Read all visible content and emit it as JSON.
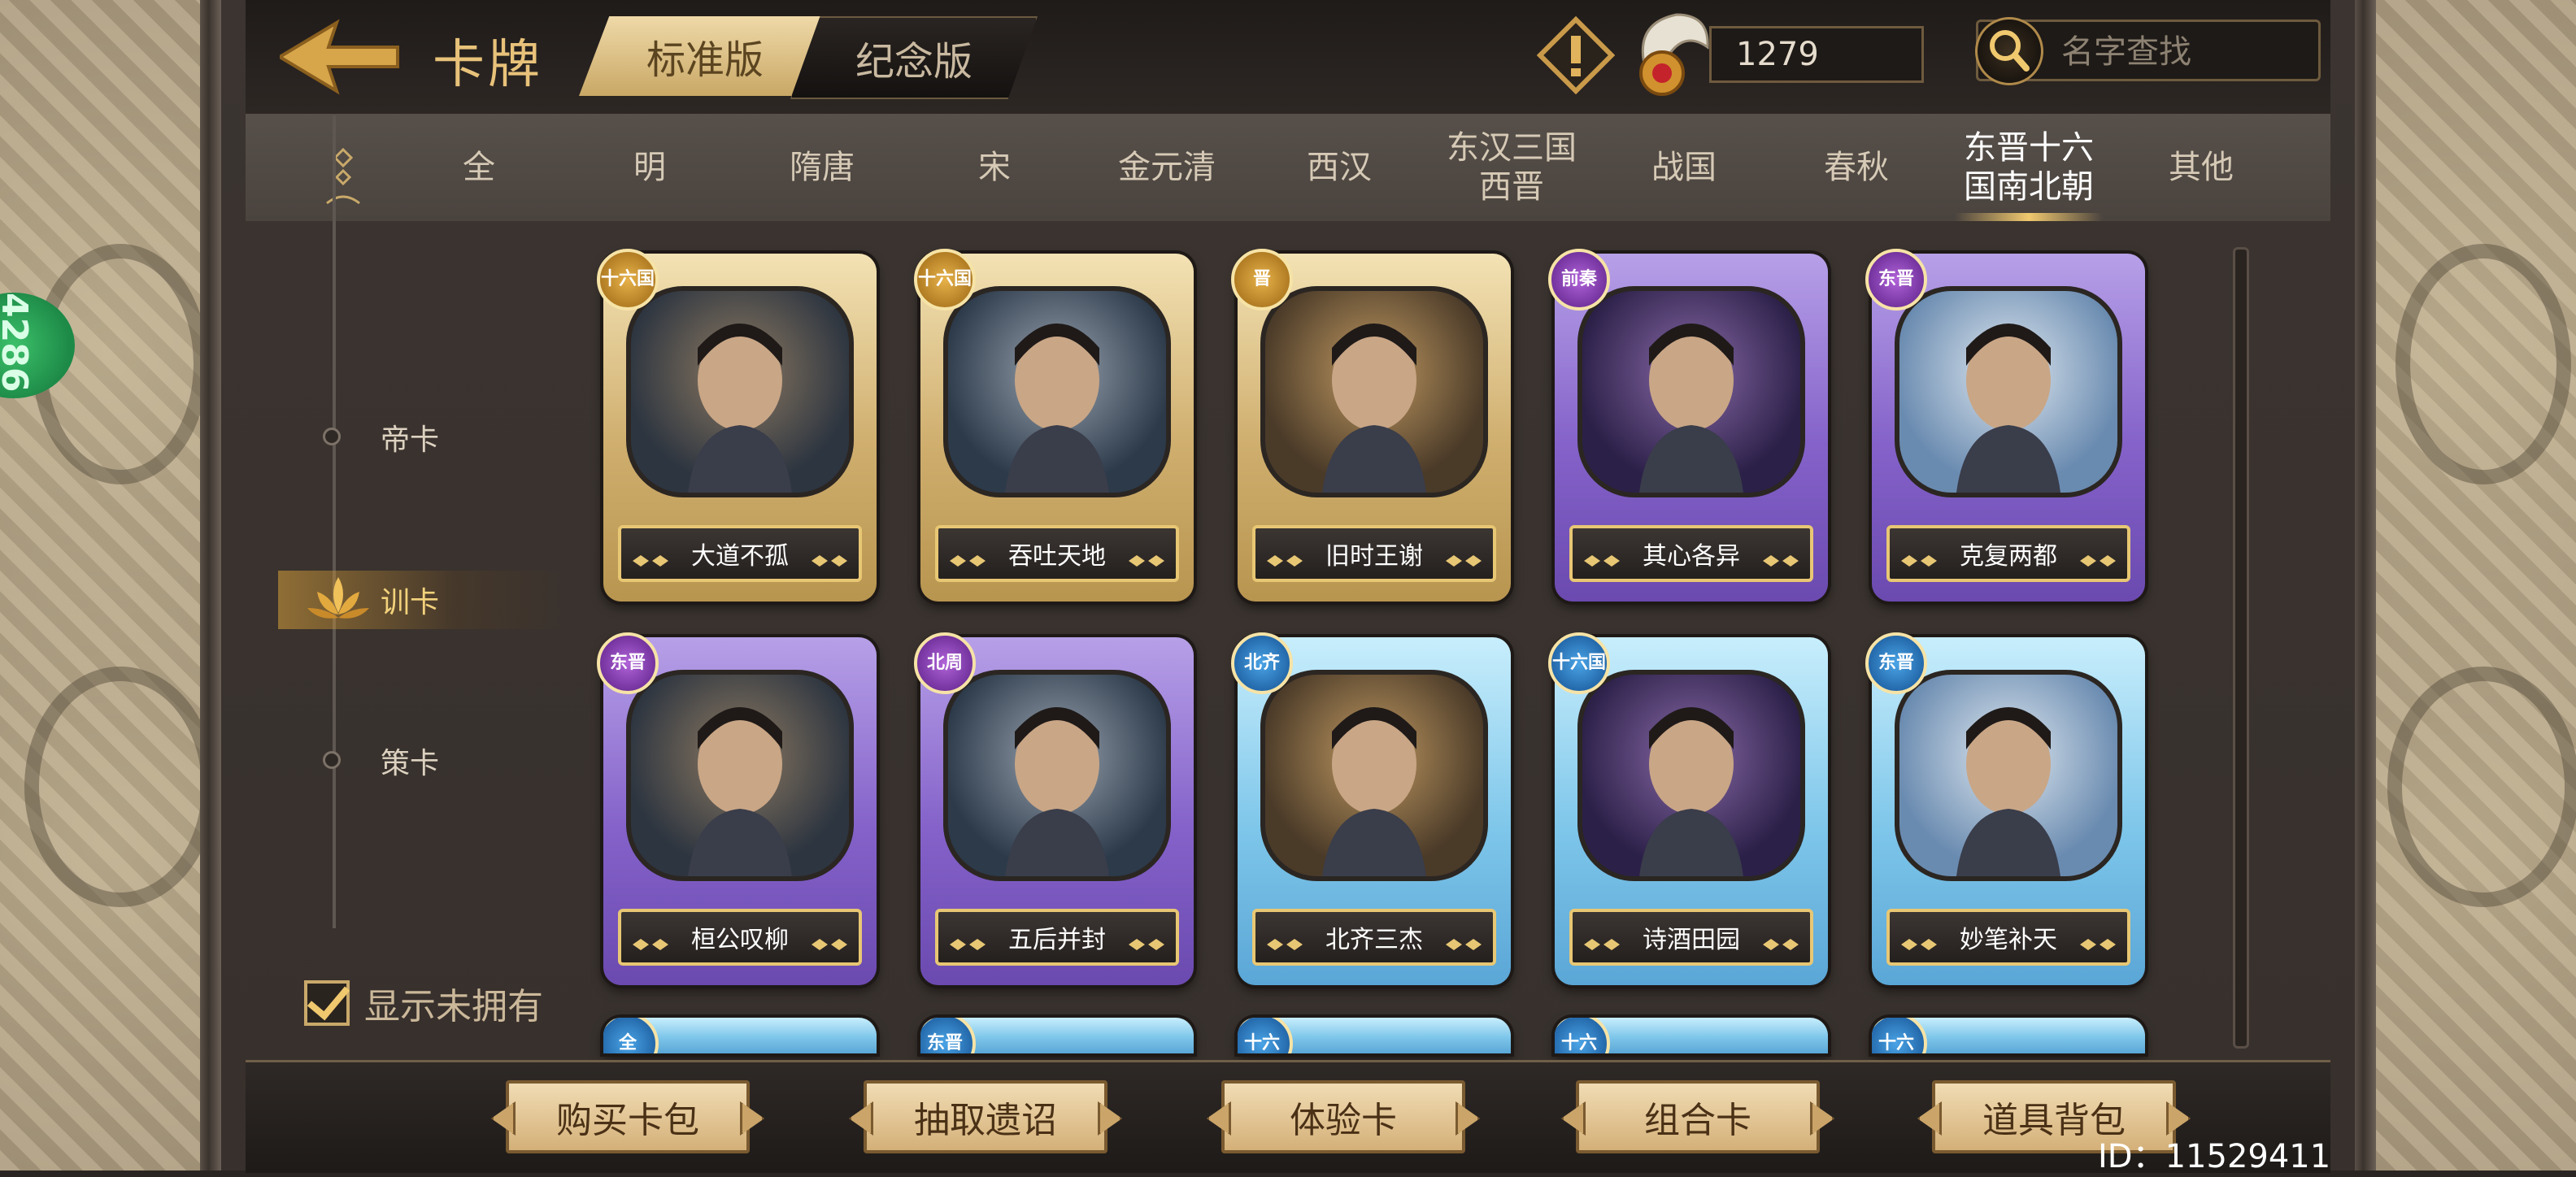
{
  "header": {
    "title": "卡牌",
    "edition_tabs": [
      {
        "label": "标准版",
        "active": true
      },
      {
        "label": "纪念版",
        "active": false
      }
    ],
    "currency_value": "1279",
    "search": {
      "placeholder": "名字查找"
    }
  },
  "era_tabs": [
    {
      "label": "全"
    },
    {
      "label": "明"
    },
    {
      "label": "隋唐"
    },
    {
      "label": "宋"
    },
    {
      "label": "金元清"
    },
    {
      "label": "西汉"
    },
    {
      "label": "东汉三国西晋",
      "line1": "东汉三国",
      "line2": "西晋"
    },
    {
      "label": "战国"
    },
    {
      "label": "春秋"
    },
    {
      "label": "东晋十六国南北朝",
      "line1": "东晋十六",
      "line2": "国南北朝",
      "active": true
    },
    {
      "label": "其他"
    }
  ],
  "card_types": [
    {
      "label": "帝卡"
    },
    {
      "label": "训卡",
      "active": true
    },
    {
      "label": "策卡"
    }
  ],
  "show_unowned": {
    "label": "显示未拥有",
    "checked": true
  },
  "side_badge": "4286",
  "cards": [
    {
      "name": "大道不孤",
      "faction": "十六国",
      "frame": "gold"
    },
    {
      "name": "吞吐天地",
      "faction": "十六国",
      "frame": "gold"
    },
    {
      "name": "旧时王谢",
      "faction": "晋",
      "frame": "gold"
    },
    {
      "name": "其心各异",
      "faction": "前秦",
      "frame": "purple"
    },
    {
      "name": "克复两都",
      "faction": "东晋",
      "frame": "purple"
    },
    {
      "name": "桓公叹柳",
      "faction": "东晋",
      "frame": "purple"
    },
    {
      "name": "五后并封",
      "faction": "北周",
      "frame": "purple"
    },
    {
      "name": "北齐三杰",
      "faction": "北齐",
      "frame": "blue"
    },
    {
      "name": "诗酒田园",
      "faction": "十六国",
      "frame": "blue"
    },
    {
      "name": "妙笔补天",
      "faction": "东晋",
      "frame": "blue"
    }
  ],
  "partial_cards": [
    {
      "faction": "全",
      "frame": "blue"
    },
    {
      "faction": "东晋",
      "frame": "blue"
    },
    {
      "faction": "十六",
      "frame": "blue"
    },
    {
      "faction": "十六",
      "frame": "blue"
    },
    {
      "faction": "十六",
      "frame": "blue"
    }
  ],
  "bottom_buttons": [
    {
      "label": "购买卡包"
    },
    {
      "label": "抽取遗诏"
    },
    {
      "label": "体验卡"
    },
    {
      "label": "组合卡"
    },
    {
      "label": "道具背包"
    }
  ],
  "user_id": "ID：11529411",
  "colors": {
    "accent_gold": "#e8c27a",
    "frame_gold": "#cfae6e",
    "frame_purple": "#8462c9",
    "frame_blue": "#7ec6ea"
  }
}
